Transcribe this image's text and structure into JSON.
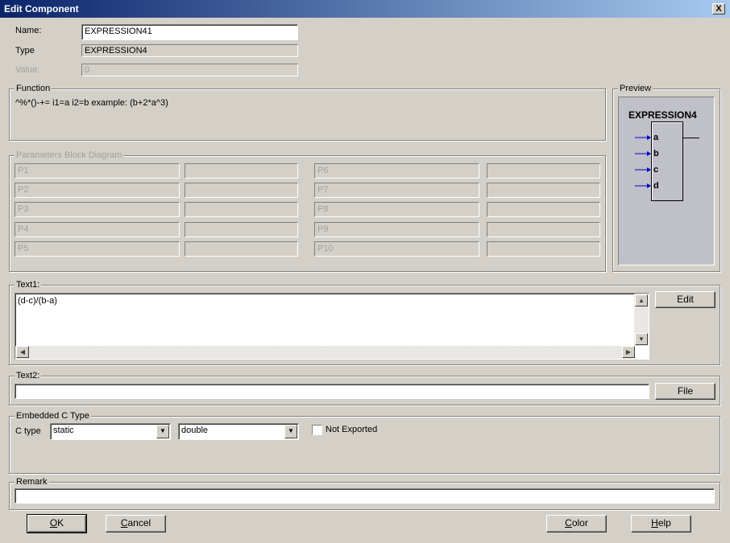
{
  "window": {
    "title": "Edit Component",
    "close_glyph": "X"
  },
  "name_label": "Name:",
  "name_value": "EXPRESSION41",
  "type_label": "Type",
  "type_value": "EXPRESSION4",
  "value_label": "Value:",
  "value_value": "0",
  "function": {
    "legend": "Function",
    "text": "^%*()-+= i1=a i2=b example: (b+2*a^3)"
  },
  "preview": {
    "legend": "Preview",
    "block_title": "EXPRESSION4",
    "inputs": [
      "a",
      "b",
      "c",
      "d"
    ],
    "arrow_color": "#0000cc"
  },
  "params": {
    "legend": "Parameters Block Diagram",
    "left": [
      "P1",
      "P2",
      "P3",
      "P4",
      "P5"
    ],
    "right": [
      "P6",
      "P7",
      "P8",
      "P9",
      "P10"
    ]
  },
  "text1": {
    "legend": "Text1:",
    "value": "(d-c)/(b-a)",
    "edit_button": "Edit"
  },
  "text2": {
    "legend": "Text2:",
    "value": "",
    "file_button": "File"
  },
  "embedded": {
    "legend": "Embedded C Type",
    "ctype_label": "C type",
    "ctype_value": "static",
    "type_value": "double",
    "not_exported_label": "Not Exported",
    "not_exported_checked": false
  },
  "remark": {
    "legend": "Remark",
    "value": ""
  },
  "buttons": {
    "ok": {
      "mnemonic": "O",
      "rest": "K"
    },
    "cancel": {
      "mnemonic": "C",
      "rest": "ancel"
    },
    "color": {
      "mnemonic": "C",
      "rest": "olor"
    },
    "help": {
      "mnemonic": "H",
      "rest": "elp"
    }
  },
  "colors": {
    "title_start": "#0a246a",
    "title_end": "#a6caf0",
    "face": "#d4d0c8",
    "preview_bg": "#c0c0c8"
  }
}
